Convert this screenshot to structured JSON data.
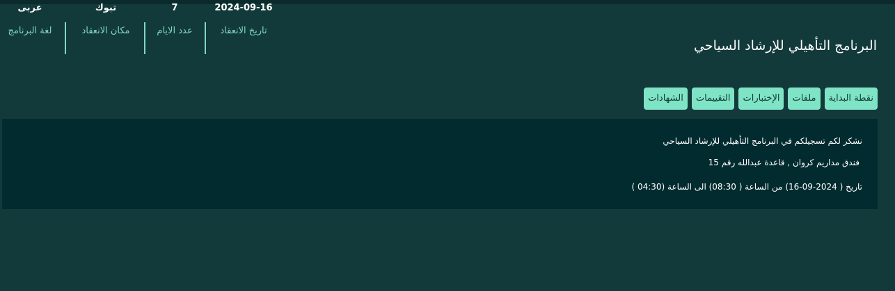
{
  "program": {
    "title": "البرنامج التأهيلي للإرشاد السياحي"
  },
  "stats": [
    {
      "value": "2024-09-16",
      "label": "تاريخ الانعقاد"
    },
    {
      "value": "7",
      "label": "عدد الايام"
    },
    {
      "value": "تبوك",
      "label": "مكان الانعقاد"
    },
    {
      "value": "عربى",
      "label": "لغة البرنامج"
    }
  ],
  "tabs": [
    {
      "label": "نقطة البداية"
    },
    {
      "label": "ملفات"
    },
    {
      "label": "الإختبارات"
    },
    {
      "label": "التقييمات"
    },
    {
      "label": "الشهادات"
    }
  ],
  "content": {
    "line1": "نشكر لكم تسجيلكم في البرنامج التأهيلي للإرشاد السياحي",
    "line2": "فندق مداريم كروان , قاعدة عبدالله رقم 15",
    "line3": "تاريخ ( 2024-09-16) من الساعة ( 08:30) الى الساعة (04:30 )"
  },
  "colors": {
    "background": "#133a3a",
    "panel": "#022b2f",
    "accent": "#7fe3c6",
    "label": "#7fd8c2"
  }
}
